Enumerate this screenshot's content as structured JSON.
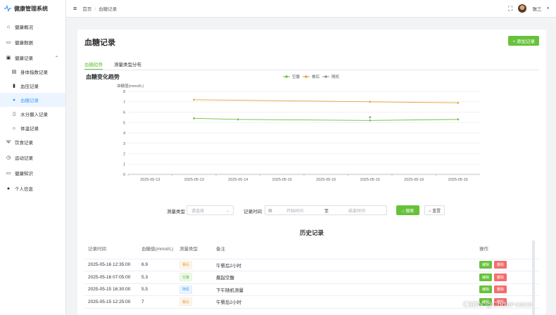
{
  "app": {
    "title": "健康管理系统"
  },
  "sidebar": {
    "items": [
      {
        "label": "健康概况",
        "icon": "home-icon"
      },
      {
        "label": "健康数据",
        "icon": "monitor-icon"
      },
      {
        "label": "健康记录",
        "icon": "record-icon"
      },
      {
        "label": "身体指数记录",
        "icon": "document-icon"
      },
      {
        "label": "血压记录",
        "icon": "bar-icon"
      },
      {
        "label": "血糖记录",
        "icon": "drop-icon"
      },
      {
        "label": "水分摄入记录",
        "icon": "cup-icon"
      },
      {
        "label": "体温记录",
        "icon": "sun-icon"
      },
      {
        "label": "饮食记录",
        "icon": "fork-icon"
      },
      {
        "label": "运动记录",
        "icon": "timer-icon"
      },
      {
        "label": "健康知识",
        "icon": "book-icon"
      },
      {
        "label": "个人信息",
        "icon": "user-icon"
      }
    ]
  },
  "header": {
    "breadcrumb": [
      "首页",
      "血糖记录"
    ],
    "user_name": "张三"
  },
  "page": {
    "title": "血糖记录",
    "add_button": "+ 添加记录",
    "tabs": [
      "血糖趋势",
      "测量类型分布"
    ],
    "chart_title": "血糖变化趋势"
  },
  "chart_data": {
    "type": "line",
    "ylabel": "血糖值(mmol/L)",
    "ylim": [
      0,
      8
    ],
    "yticks": [
      "0",
      "1",
      "2",
      "3",
      "4",
      "5",
      "6",
      "7",
      "8"
    ],
    "categories": [
      "2025-05-13",
      "2025-05-13",
      "2025-05-14",
      "2025-05-15",
      "2025-05-15",
      "2025-05-15",
      "2025-05-16",
      "2025-05-16"
    ],
    "series": [
      {
        "name": "空腹",
        "color": "#67c23a",
        "points": [
          [
            1,
            5.4
          ],
          [
            2,
            5.3
          ],
          [
            5,
            5.2
          ],
          [
            7,
            5.3
          ]
        ]
      },
      {
        "name": "餐后",
        "color": "#e6a23c",
        "points": [
          [
            1,
            7.2
          ],
          [
            5,
            7.0
          ],
          [
            7,
            6.9
          ]
        ]
      },
      {
        "name": "随机",
        "color": "#909399",
        "points": [
          [
            5,
            5.5
          ]
        ]
      }
    ],
    "legend": "top-center",
    "grid": true
  },
  "filter": {
    "type_label": "测量类型",
    "type_placeholder": "请选择",
    "time_label": "记录时间",
    "start_placeholder": "开始时间",
    "to": "至",
    "end_placeholder": "结束时间",
    "search": "○ 搜索",
    "reset": "○ 重置"
  },
  "history": {
    "title": "历史记录",
    "columns": [
      "记录时间",
      "血糖值(mmol/L)",
      "测量类型",
      "备注",
      "操作"
    ],
    "rows": [
      {
        "time": "2025-05-16 12:35:00",
        "value": "6.9",
        "type": "餐后",
        "note": "午餐后2小时",
        "tag": "c1"
      },
      {
        "time": "2025-05-16 07:05:00",
        "value": "5.3",
        "type": "空腹",
        "note": "晨起空腹",
        "tag": "c2"
      },
      {
        "time": "2025-05-15 16:30:00",
        "value": "5.5",
        "type": "随机",
        "note": "下午随机测量",
        "tag": "c3"
      },
      {
        "time": "2025-05-15 12:25:00",
        "value": "7",
        "type": "餐后",
        "note": "午餐后2小时",
        "tag": "c1"
      }
    ],
    "edit": "编辑",
    "delete": "删除"
  },
  "watermark": "CSDN @Coder-coco"
}
